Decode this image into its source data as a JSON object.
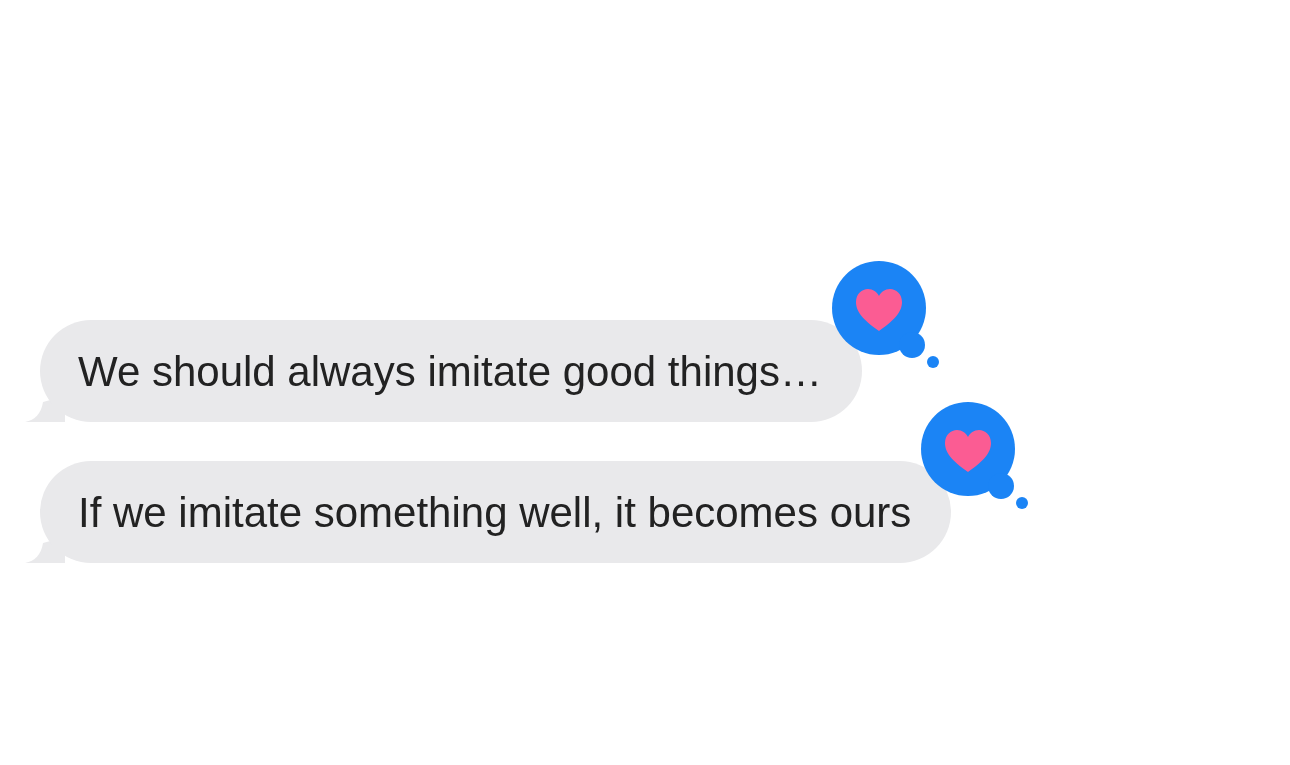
{
  "messages": [
    {
      "text": "We should always imitate good things…",
      "reaction": {
        "kind": "heart"
      }
    },
    {
      "text": "If we imitate something well, it becomes ours",
      "reaction": {
        "kind": "heart"
      }
    }
  ]
}
